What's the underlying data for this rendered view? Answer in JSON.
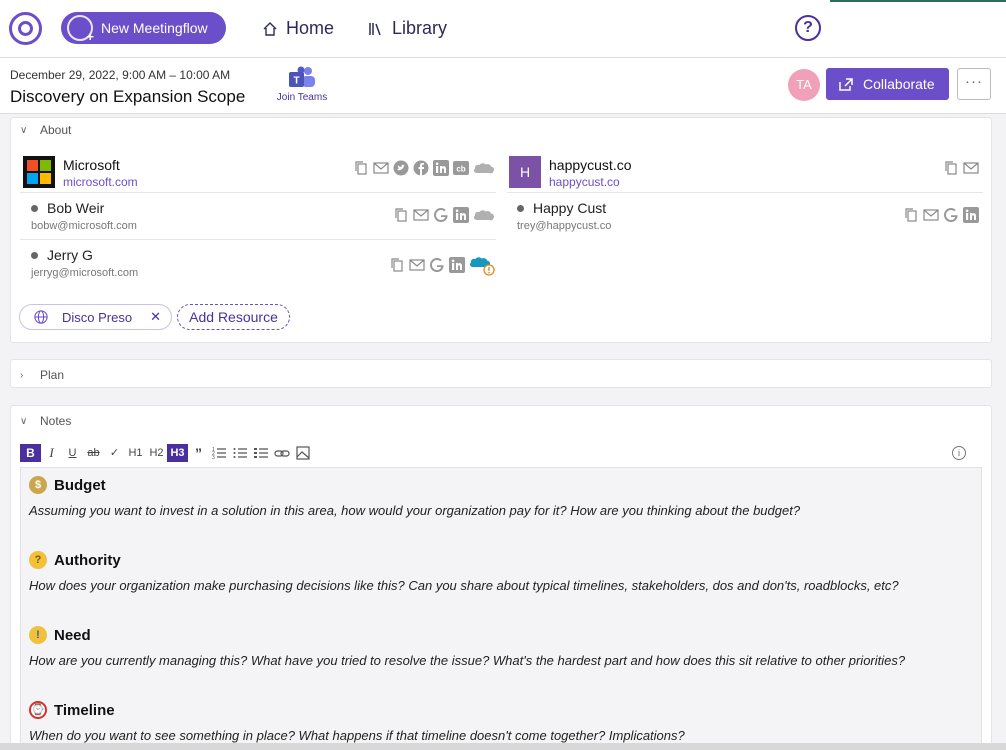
{
  "topbar": {
    "new_button": "New Meetingflow",
    "nav_home": "Home",
    "nav_library": "Library",
    "help": "?"
  },
  "header": {
    "datetime": "December 29, 2022, 9:00 AM – 10:00 AM",
    "title": "Discovery on Expansion Scope",
    "join_teams": "Join Teams",
    "avatar_initials": "TA",
    "collaborate": "Collaborate",
    "more": "···"
  },
  "about": {
    "title": "About",
    "companies": [
      {
        "name": "Microsoft",
        "domain": "microsoft.com",
        "icons": [
          "copy-icon",
          "mail-icon",
          "twitter-icon",
          "facebook-icon",
          "linkedin-icon",
          "crunchbase-icon",
          "salesforce-icon"
        ],
        "people": [
          {
            "name": "Bob Weir",
            "email": "bobw@microsoft.com",
            "icons": [
              "copy-icon",
              "mail-icon",
              "google-icon",
              "linkedin-icon",
              "salesforce-icon"
            ]
          },
          {
            "name": "Jerry G",
            "email": "jerryg@microsoft.com",
            "icons": [
              "copy-icon",
              "mail-icon",
              "google-icon",
              "linkedin-icon",
              "salesforce-warning-icon"
            ]
          }
        ]
      },
      {
        "name": "happycust.co",
        "domain": "happycust.co",
        "logo_letter": "H",
        "icons": [
          "copy-icon",
          "mail-icon"
        ],
        "people": [
          {
            "name": "Happy Cust",
            "email": "trey@happycust.co",
            "icons": [
              "copy-icon",
              "mail-icon",
              "google-icon",
              "linkedin-icon"
            ]
          }
        ]
      }
    ],
    "resource_chip": "Disco Preso",
    "add_resource": "Add Resource"
  },
  "plan": {
    "title": "Plan"
  },
  "notes": {
    "title": "Notes",
    "toolbar": [
      "B",
      "I",
      "U",
      "ab",
      "✓",
      "H1",
      "H2",
      "H3",
      "”",
      "list-ol",
      "list-ul",
      "list-check",
      "link",
      "image"
    ],
    "active_tool": "H3",
    "sections": [
      {
        "heading": "Budget",
        "emoji": "money-bag",
        "prompt": "Assuming you want to invest in a solution in this area, how would your organization pay for it? How are you thinking about the budget?"
      },
      {
        "heading": "Authority",
        "emoji": "thinking-face",
        "prompt": "How does your organization make purchasing decisions like this? Can you share about typical timelines, stakeholders, dos and don'ts, roadblocks, etc?"
      },
      {
        "heading": "Need",
        "emoji": "screaming-face",
        "prompt": "How are you currently managing this? What have you tried to resolve the issue? What's the hardest part and how does this sit relative to other priorities?"
      },
      {
        "heading": "Timeline",
        "emoji": "alarm-clock",
        "prompt": "When do you want to see something in place? What happens if that timeline doesn't come together? Implications?"
      }
    ]
  },
  "colors": {
    "accent": "#6b4ec9",
    "dark_accent": "#4a2f9e"
  }
}
